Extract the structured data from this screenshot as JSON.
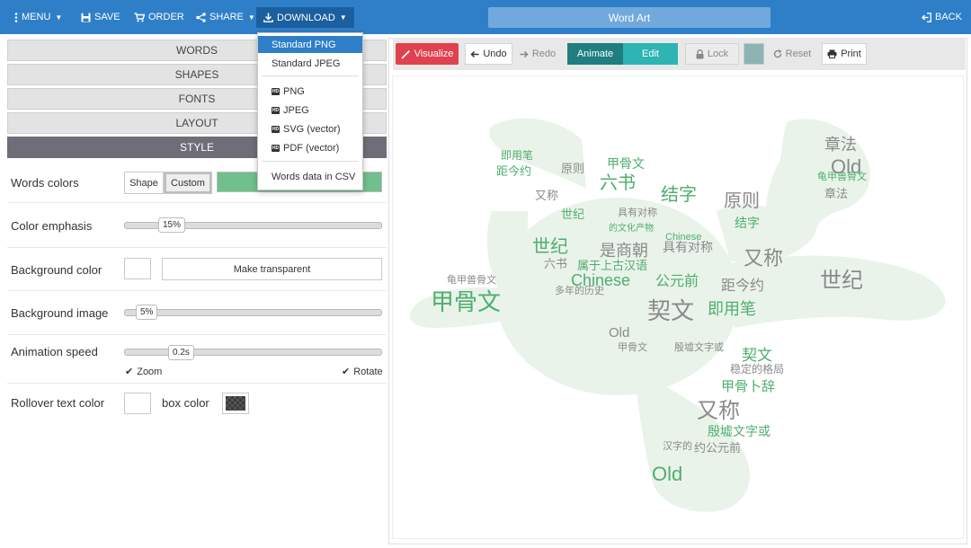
{
  "topbar": {
    "menu_label": "MENU",
    "save_label": "SAVE",
    "order_label": "ORDER",
    "share_label": "SHARE",
    "download_label": "DOWNLOAD",
    "title": "Word Art",
    "back_label": "BACK"
  },
  "download_menu": {
    "items": [
      "Standard PNG",
      "Standard JPEG",
      "PNG",
      "JPEG",
      "SVG (vector)",
      "PDF (vector)",
      "Words data in CSV"
    ],
    "selected": "Standard PNG"
  },
  "accordion": {
    "words": "WORDS",
    "shapes": "SHAPES",
    "fonts": "FONTS",
    "layout": "LAYOUT",
    "style": "STYLE"
  },
  "style_panel": {
    "words_colors_label": "Words colors",
    "shape_option": "Shape",
    "custom_option": "Custom",
    "color_emphasis_label": "Color emphasis",
    "color_emphasis_value": "15%",
    "background_color_label": "Background color",
    "make_transparent_label": "Make transparent",
    "background_image_label": "Background image",
    "background_image_value": "5%",
    "animation_speed_label": "Animation speed",
    "animation_speed_value": "0.2s",
    "zoom_label": "Zoom",
    "rotate_label": "Rotate",
    "rollover_text_color_label": "Rollover text color",
    "box_color_label": "box color"
  },
  "toolbar": {
    "visualize_label": "Visualize",
    "undo_label": "Undo",
    "redo_label": "Redo",
    "animate_label": "Animate",
    "edit_label": "Edit",
    "lock_label": "Lock",
    "reset_label": "Reset",
    "print_label": "Print"
  },
  "colors": {
    "topbar": "#2f7fc8",
    "accent_red": "#e0414f",
    "accent_teal": "#2a9d9a",
    "word_green": "#4fae6e",
    "word_gray": "#8a8a8a",
    "custom_color": "#6fc08c"
  },
  "word_cloud": {
    "words": [
      "甲骨文",
      "契文",
      "又称",
      "世纪",
      "章法",
      "Old",
      "Chinese",
      "结字",
      "原则",
      "六书",
      "是商朝",
      "即用笔",
      "距今约",
      "公元前",
      "殷墟文字",
      "甲骨卜辞",
      "汉字的",
      "多年的历史",
      "属于上古汉语",
      "稳定的格局",
      "具有对称",
      "龟甲兽骨文",
      "约公元前",
      "又称",
      "结字",
      "世纪",
      "原则",
      "Old",
      "章法"
    ]
  }
}
